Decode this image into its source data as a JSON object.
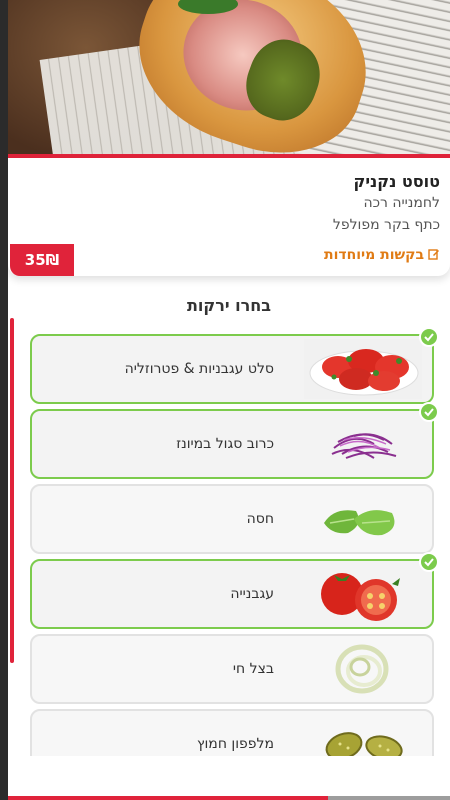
{
  "product": {
    "title": "טוסט נקניק",
    "line1": "לחמנייה רכה",
    "line2": "כתף בקר מפולפל",
    "special_requests": "בקשות מיוחדות",
    "price": "35₪"
  },
  "section": {
    "title": "בחרו ירקות"
  },
  "options": [
    {
      "label": "סלט עגבניות & פטרוזליה",
      "selected": true,
      "icon": "tomato-salad-icon"
    },
    {
      "label": "כרוב סגול במיונז",
      "selected": true,
      "icon": "purple-cabbage-icon"
    },
    {
      "label": "חסה",
      "selected": false,
      "icon": "lettuce-icon"
    },
    {
      "label": "עגבנייה",
      "selected": true,
      "icon": "tomato-icon"
    },
    {
      "label": "בצל חי",
      "selected": false,
      "icon": "onion-icon"
    },
    {
      "label": "מלפפון חמוץ",
      "selected": false,
      "icon": "pickle-icon"
    }
  ],
  "colors": {
    "accent_red": "#e0233a",
    "selected_green": "#7ccb4c",
    "special_orange": "#e07b14"
  }
}
